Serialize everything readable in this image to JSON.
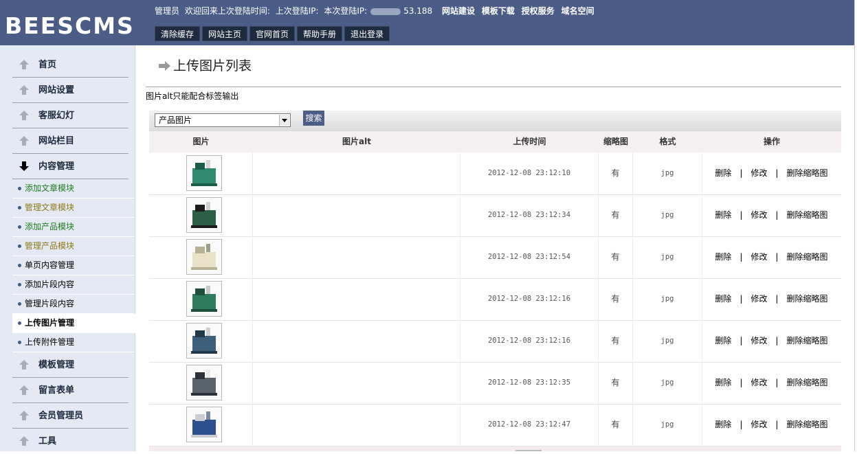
{
  "header": {
    "logo": "BEESCMS",
    "role": "管理员",
    "welcome": "欢迎回来上次登陆时间:",
    "last_ip_label": "上次登陆IP:",
    "this_ip_label": "本次登陆IP:",
    "ip_tail": "53.188",
    "links": [
      "网站建设",
      "模板下载",
      "授权服务",
      "域名空间"
    ],
    "buttons": [
      "清除缓存",
      "网站主页",
      "官网首页",
      "帮助手册",
      "退出登录"
    ]
  },
  "sidebar": {
    "main_items": [
      "首页",
      "网站设置",
      "客服幻灯",
      "网站栏目",
      "内容管理",
      "模板管理",
      "留言表单",
      "会员管理员",
      "工具"
    ],
    "sub_items": [
      "添加文章模块",
      "管理文章模块",
      "添加产品模块",
      "管理产品模块",
      "单页内容管理",
      "添加片段内容",
      "管理片段内容",
      "上传图片管理",
      "上传附件管理"
    ],
    "active": "上传图片管理"
  },
  "main": {
    "title": "上传图片列表",
    "note": "图片alt只能配合标签输出",
    "filter_selected": "产品图片",
    "search_label": "搜索",
    "columns": [
      "图片",
      "图片alt",
      "上传时间",
      "缩略图",
      "格式",
      "操作"
    ],
    "rows": [
      {
        "alt": "",
        "time": "2012-12-08 23:12:10",
        "thumb": "有",
        "format": "jpg"
      },
      {
        "alt": "",
        "time": "2012-12-08 23:12:34",
        "thumb": "有",
        "format": "jpg"
      },
      {
        "alt": "",
        "time": "2012-12-08 23:12:54",
        "thumb": "有",
        "format": "jpg"
      },
      {
        "alt": "",
        "time": "2012-12-08 23:12:16",
        "thumb": "有",
        "format": "jpg"
      },
      {
        "alt": "",
        "time": "2012-12-08 23:12:16",
        "thumb": "有",
        "format": "jpg"
      },
      {
        "alt": "",
        "time": "2012-12-08 23:12:35",
        "thumb": "有",
        "format": "jpg"
      },
      {
        "alt": "",
        "time": "2012-12-08 23:12:47",
        "thumb": "有",
        "format": "jpg"
      }
    ],
    "ops": {
      "delete": "删除",
      "edit": "修改",
      "delete_thumb": "删除缩略图",
      "sep": "|"
    }
  },
  "colors": {
    "header_bg": "#4b5d87",
    "sidebar_bg": "#e4e9f3",
    "button_bg": "#1e2a3d"
  }
}
